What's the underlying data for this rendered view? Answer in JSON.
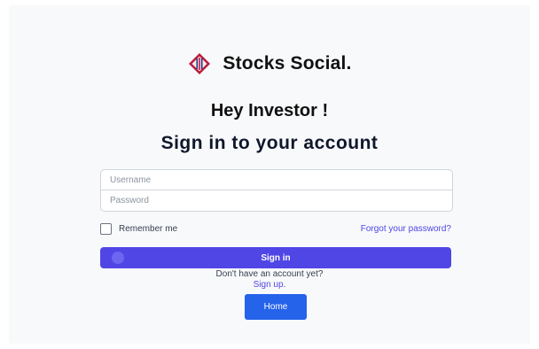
{
  "brand": {
    "name": "Stocks Social.",
    "logo_icon": "stocks-social-logo-icon"
  },
  "greeting": "Hey Investor !",
  "title": "Sign in to your account",
  "form": {
    "username_placeholder": "Username",
    "password_placeholder": "Password",
    "remember_label": "Remember me",
    "remember_checked": false,
    "forgot_link": "Forgot your password?",
    "signin_label": "Sign in"
  },
  "signup": {
    "prompt": "Don't have an account yet?",
    "link": "Sign up."
  },
  "home_button": "Home",
  "colors": {
    "primary": "#5046e5",
    "link": "#4f46e5",
    "home": "#2563eb",
    "logo_red": "#b91c3c",
    "logo_blue": "#1e3a8a"
  }
}
